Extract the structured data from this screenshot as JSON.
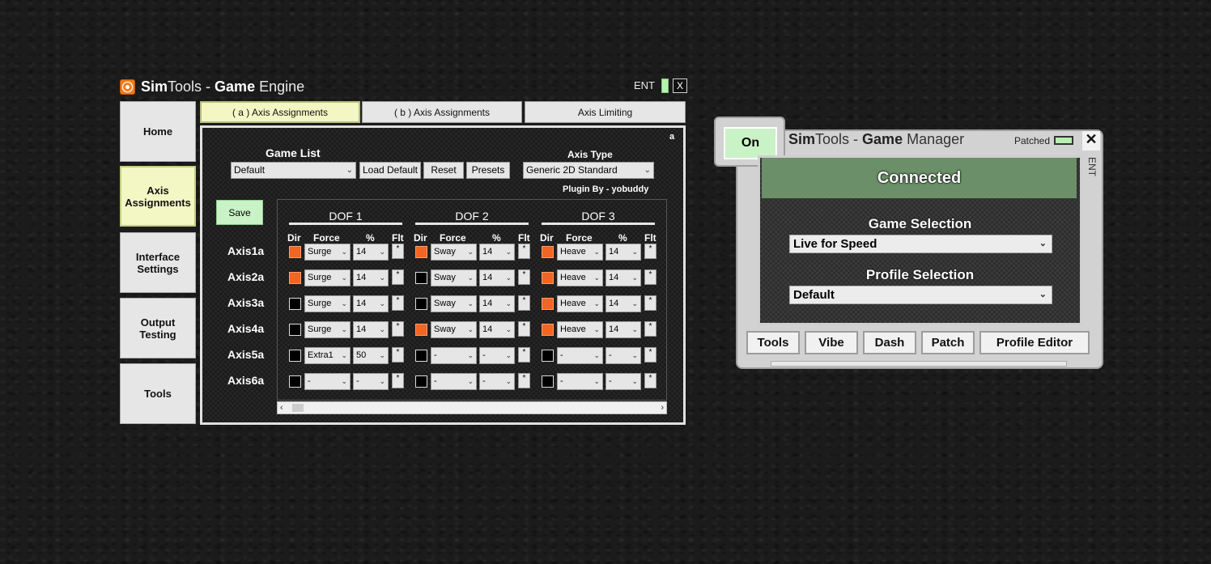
{
  "engine": {
    "title_a": "Sim",
    "title_b": "Tools - ",
    "title_c": "Game",
    "title_d": " Engine",
    "ent": "ENT",
    "close": "X",
    "sidebar": [
      {
        "label": "Home"
      },
      {
        "label": "Axis Assignments",
        "active": true
      },
      {
        "label": "Interface Settings"
      },
      {
        "label": "Output Testing"
      },
      {
        "label": "Tools"
      }
    ],
    "tabs": [
      {
        "label": "( a ) Axis Assignments",
        "active": true
      },
      {
        "label": "( b ) Axis Assignments"
      },
      {
        "label": "Axis Limiting"
      }
    ],
    "panel_corner": "a",
    "game_list_label": "Game List",
    "game_list_value": "Default",
    "load_default": "Load Default",
    "reset": "Reset",
    "presets": "Presets",
    "axis_type_label": "Axis Type",
    "axis_type_value": "Generic 2D Standard",
    "plugin_by": "Plugin By - yobuddy",
    "save": "Save",
    "dof_headers": [
      "DOF 1",
      "DOF 2",
      "DOF 3"
    ],
    "col_headers": {
      "dir": "Dir",
      "force": "Force",
      "pct": "%",
      "flt": "Flt"
    },
    "flt_mark": "*",
    "axes": [
      {
        "label": "Axis1a",
        "cells": [
          {
            "dir": true,
            "force": "Surge",
            "pct": "14"
          },
          {
            "dir": true,
            "force": "Sway",
            "pct": "14"
          },
          {
            "dir": true,
            "force": "Heave",
            "pct": "14"
          }
        ]
      },
      {
        "label": "Axis2a",
        "cells": [
          {
            "dir": true,
            "force": "Surge",
            "pct": "14"
          },
          {
            "dir": false,
            "force": "Sway",
            "pct": "14"
          },
          {
            "dir": true,
            "force": "Heave",
            "pct": "14"
          }
        ]
      },
      {
        "label": "Axis3a",
        "cells": [
          {
            "dir": false,
            "force": "Surge",
            "pct": "14"
          },
          {
            "dir": false,
            "force": "Sway",
            "pct": "14"
          },
          {
            "dir": true,
            "force": "Heave",
            "pct": "14"
          }
        ]
      },
      {
        "label": "Axis4a",
        "cells": [
          {
            "dir": false,
            "force": "Surge",
            "pct": "14"
          },
          {
            "dir": true,
            "force": "Sway",
            "pct": "14"
          },
          {
            "dir": true,
            "force": "Heave",
            "pct": "14"
          }
        ]
      },
      {
        "label": "Axis5a",
        "cells": [
          {
            "dir": false,
            "force": "Extra1",
            "pct": "50"
          },
          {
            "dir": false,
            "force": "-",
            "pct": "-"
          },
          {
            "dir": false,
            "force": "-",
            "pct": "-"
          }
        ]
      },
      {
        "label": "Axis6a",
        "cells": [
          {
            "dir": false,
            "force": "-",
            "pct": "-"
          },
          {
            "dir": false,
            "force": "-",
            "pct": "-"
          },
          {
            "dir": false,
            "force": "-",
            "pct": "-"
          }
        ]
      }
    ]
  },
  "manager": {
    "on_button": "On",
    "title_a": "Sim",
    "title_b": "Tools - ",
    "title_c": "Game",
    "title_d": " Manager",
    "patched": "Patched",
    "close": "✕",
    "ent": "ENT",
    "status": "Connected",
    "game_selection_label": "Game Selection",
    "game_selection_value": "Live for Speed",
    "profile_selection_label": "Profile Selection",
    "profile_selection_value": "Default",
    "buttons": [
      "Tools",
      "Vibe",
      "Dash",
      "Patch",
      "Profile Editor"
    ]
  },
  "colors": {
    "dir_on": "#f26522",
    "active_tab": "#f3f7c4",
    "save_green": "#c9f3c6",
    "connected_green": "#6b8f69"
  }
}
